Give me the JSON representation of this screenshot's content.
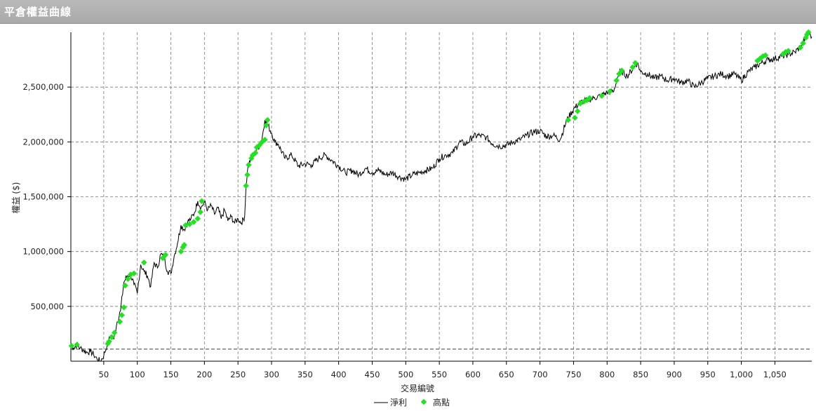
{
  "window": {
    "title": "平倉權益曲線"
  },
  "colors": {
    "line": "#000000",
    "marker": "#22e022",
    "grid": "#777777",
    "header": "#aaaaaa"
  },
  "chart_data": {
    "type": "line",
    "xlabel": "交易編號",
    "ylabel": "權益 ($)",
    "xlim": [
      1,
      1105
    ],
    "ylim": [
      0,
      3000000
    ],
    "x_ticks": [
      50,
      100,
      150,
      200,
      250,
      300,
      350,
      400,
      450,
      500,
      550,
      600,
      650,
      700,
      750,
      800,
      850,
      900,
      950,
      1000,
      1050
    ],
    "x_tick_labels": [
      "50",
      "100",
      "150",
      "200",
      "250",
      "300",
      "350",
      "400",
      "450",
      "500",
      "550",
      "600",
      "650",
      "700",
      "750",
      "800",
      "850",
      "900",
      "950",
      "1,000",
      "1,050"
    ],
    "y_ticks": [
      500000,
      1000000,
      1500000,
      2000000,
      2500000
    ],
    "y_tick_labels": [
      "500,000",
      "1,000,000",
      "1,500,000",
      "2,000,000",
      "2,500,000"
    ],
    "reference_line": {
      "y": 110000
    },
    "grid": true,
    "legend": {
      "position": "bottom-center",
      "entries": [
        "淨利",
        "高點"
      ]
    },
    "series": [
      {
        "name": "淨利",
        "x": [
          1,
          5,
          10,
          15,
          20,
          25,
          30,
          35,
          40,
          45,
          50,
          55,
          60,
          65,
          70,
          75,
          80,
          85,
          90,
          95,
          100,
          105,
          110,
          115,
          120,
          125,
          130,
          135,
          140,
          145,
          150,
          155,
          160,
          165,
          170,
          175,
          180,
          185,
          190,
          195,
          200,
          205,
          210,
          215,
          220,
          225,
          230,
          235,
          240,
          245,
          250,
          255,
          260,
          262,
          265,
          270,
          275,
          280,
          285,
          290,
          295,
          300,
          305,
          310,
          320,
          330,
          340,
          350,
          360,
          370,
          380,
          390,
          400,
          410,
          420,
          430,
          440,
          450,
          460,
          470,
          480,
          490,
          500,
          510,
          520,
          530,
          540,
          550,
          560,
          570,
          580,
          590,
          600,
          610,
          620,
          630,
          640,
          650,
          660,
          670,
          680,
          690,
          700,
          710,
          720,
          730,
          740,
          750,
          760,
          770,
          780,
          790,
          800,
          810,
          815,
          820,
          830,
          840,
          845,
          850,
          860,
          870,
          880,
          890,
          900,
          910,
          920,
          930,
          940,
          950,
          960,
          970,
          980,
          990,
          1000,
          1010,
          1020,
          1030,
          1040,
          1050,
          1060,
          1070,
          1080,
          1090,
          1095,
          1100,
          1105
        ],
        "values": [
          140000,
          120000,
          150000,
          120000,
          100000,
          80000,
          90000,
          60000,
          20000,
          0,
          50000,
          150000,
          230000,
          200000,
          360000,
          460000,
          720000,
          780000,
          790000,
          700000,
          620000,
          880000,
          820000,
          780000,
          680000,
          900000,
          850000,
          980000,
          940000,
          820000,
          800000,
          960000,
          1080000,
          1240000,
          1200000,
          1270000,
          1300000,
          1350000,
          1460000,
          1400000,
          1450000,
          1380000,
          1420000,
          1340000,
          1400000,
          1300000,
          1380000,
          1280000,
          1320000,
          1260000,
          1300000,
          1260000,
          1320000,
          1600000,
          1780000,
          1860000,
          1900000,
          1950000,
          2000000,
          2200000,
          2150000,
          2080000,
          2000000,
          1980000,
          1850000,
          1880000,
          1780000,
          1800000,
          1790000,
          1850000,
          1880000,
          1830000,
          1780000,
          1720000,
          1740000,
          1700000,
          1760000,
          1720000,
          1740000,
          1700000,
          1720000,
          1680000,
          1660000,
          1700000,
          1720000,
          1740000,
          1760000,
          1850000,
          1880000,
          1900000,
          2000000,
          1980000,
          2050000,
          2060000,
          2040000,
          1980000,
          1960000,
          1970000,
          2000000,
          2020000,
          2060000,
          2090000,
          2100000,
          2050000,
          2060000,
          2020000,
          2200000,
          2300000,
          2360000,
          2380000,
          2400000,
          2420000,
          2450000,
          2460000,
          2580000,
          2650000,
          2600000,
          2680000,
          2720000,
          2640000,
          2620000,
          2580000,
          2600000,
          2560000,
          2580000,
          2540000,
          2560000,
          2500000,
          2540000,
          2580000,
          2600000,
          2620000,
          2600000,
          2620000,
          2560000,
          2640000,
          2680000,
          2720000,
          2750000,
          2760000,
          2780000,
          2800000,
          2820000,
          2880000,
          2950000,
          3000000,
          2960000
        ]
      },
      {
        "name": "高點",
        "x": [
          2,
          10,
          56,
          58,
          62,
          66,
          74,
          77,
          80,
          82,
          86,
          90,
          95,
          110,
          138,
          142,
          165,
          168,
          170,
          172,
          178,
          184,
          190,
          194,
          196,
          262,
          264,
          266,
          270,
          272,
          276,
          278,
          282,
          286,
          290,
          292,
          294,
          742,
          752,
          756,
          760,
          766,
          770,
          774,
          792,
          804,
          814,
          818,
          822,
          838,
          842,
          1024,
          1028,
          1032,
          1036,
          1062,
          1066,
          1070,
          1088,
          1092,
          1096,
          1098,
          1100
        ],
        "values": [
          140000,
          150000,
          160000,
          180000,
          220000,
          260000,
          360000,
          420000,
          490000,
          690000,
          750000,
          790000,
          800000,
          900000,
          940000,
          970000,
          1000000,
          1040000,
          1060000,
          1240000,
          1250000,
          1270000,
          1300000,
          1360000,
          1460000,
          1600000,
          1700000,
          1790000,
          1850000,
          1880000,
          1900000,
          1950000,
          1970000,
          2000000,
          2020000,
          2150000,
          2200000,
          2200000,
          2220000,
          2280000,
          2350000,
          2370000,
          2380000,
          2400000,
          2420000,
          2460000,
          2560000,
          2620000,
          2650000,
          2680000,
          2720000,
          2740000,
          2760000,
          2780000,
          2790000,
          2800000,
          2820000,
          2830000,
          2860000,
          2900000,
          2950000,
          2980000,
          3000000
        ]
      }
    ]
  }
}
